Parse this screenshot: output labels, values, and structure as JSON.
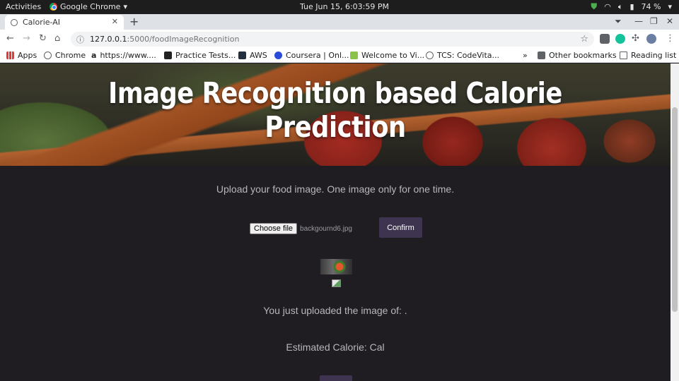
{
  "os_bar": {
    "activities": "Activities",
    "app_name": "Google Chrome",
    "clock": "Tue Jun 15,  6:03:59 PM",
    "battery": "74 %"
  },
  "browser": {
    "tab_title": "Calorie-AI",
    "url_host": "127.0.0.1",
    "url_path": ":5000/foodImageRecognition",
    "bookmarks": [
      {
        "label": "Apps"
      },
      {
        "label": "Chrome"
      },
      {
        "label": "https://www...."
      },
      {
        "label": "Practice Tests..."
      },
      {
        "label": "AWS"
      },
      {
        "label": "Coursera | Onl..."
      },
      {
        "label": "Welcome to Vi..."
      },
      {
        "label": "TCS: CodeVita..."
      }
    ],
    "overflow": "»",
    "other_bookmarks": "Other bookmarks",
    "reading_list": "Reading list"
  },
  "page": {
    "hero_title": "Image Recognition based Calorie Prediction",
    "instructions": "Upload your food image. One image only for one time.",
    "choose_file_label": "Choose file",
    "selected_file": "backgournd6.jpg",
    "confirm_label": "Confirm",
    "result_text": "You just uploaded the image of: .",
    "calorie_text": "Estimated Calorie: Cal"
  },
  "colors": {
    "page_bg": "#1f1d22",
    "button_bg": "#3e3450",
    "page_text": "#b8b6bc"
  }
}
